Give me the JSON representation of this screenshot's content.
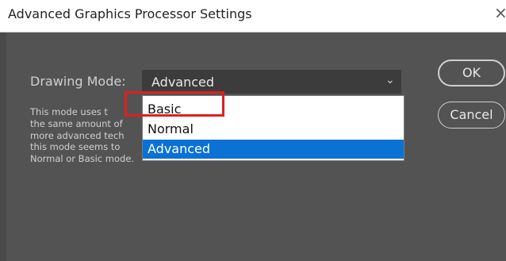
{
  "window": {
    "title": "Advanced Graphics Processor Settings",
    "close_glyph": "×"
  },
  "drawing_mode": {
    "label": "Drawing Mode:",
    "selected": "Advanced",
    "chevron": "⌄",
    "options": [
      "Basic",
      "Normal",
      "Advanced"
    ],
    "highlighted_option": "Advanced"
  },
  "description": {
    "lines": [
      "This mode uses t",
      "the same amount of",
      "more advanced tech",
      "this mode seems to",
      "Normal or Basic mode."
    ]
  },
  "buttons": {
    "ok": "OK",
    "cancel": "Cancel"
  },
  "colors": {
    "dialog_bg": "#535353",
    "selection_blue": "#0a72d4",
    "annotation_red": "#e01f1f"
  }
}
